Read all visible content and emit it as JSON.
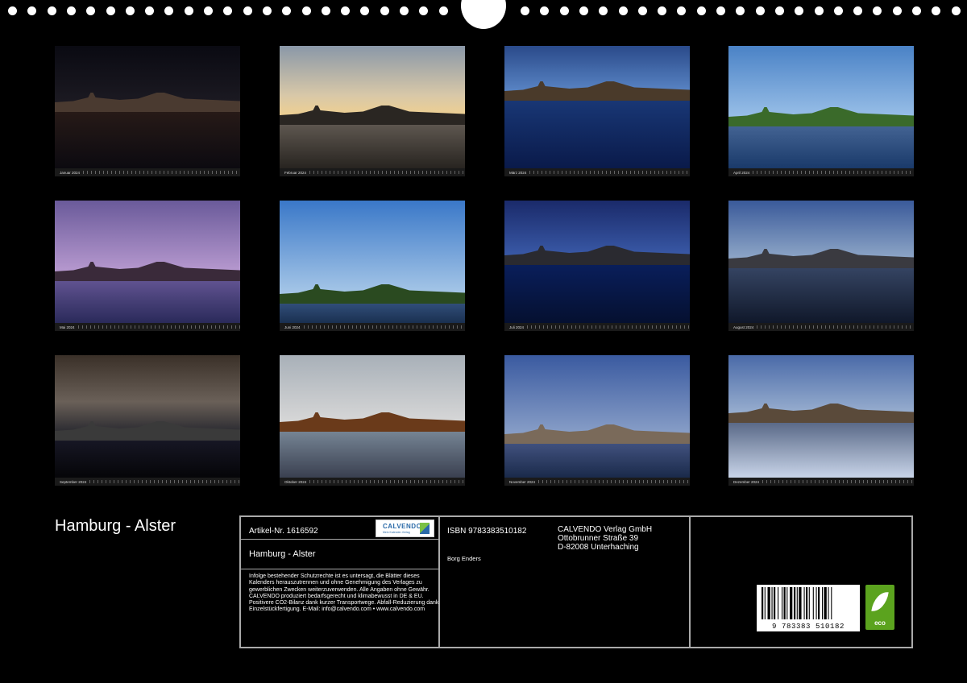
{
  "calendar": {
    "title": "Hamburg - Alster"
  },
  "months": [
    {
      "label": "Januar 2024"
    },
    {
      "label": "Februar 2024"
    },
    {
      "label": "März 2024"
    },
    {
      "label": "April 2024"
    },
    {
      "label": "Mai 2024"
    },
    {
      "label": "Juni 2024"
    },
    {
      "label": "Juli 2024"
    },
    {
      "label": "August 2024"
    },
    {
      "label": "September 2024"
    },
    {
      "label": "Oktober 2024"
    },
    {
      "label": "November 2024"
    },
    {
      "label": "Dezember 2024"
    }
  ],
  "info": {
    "article_no": "Artikel-Nr. 1616592",
    "logo_name": "CALVENDO",
    "logo_tagline": "Mein Kalender-Verlag",
    "product_title": "Hamburg - Alster",
    "legal_text": "Infolge bestehender Schutzrechte ist es untersagt, die Blätter dieses Kalenders herauszutrennen und ohne Genehmigung des Verlages zu gewerblichen Zwecken weiterzuverwenden. Alle Angaben ohne Gewähr. CALVENDO produziert bedarfsgerecht und klimabewusst in DE & EU. Positivere CO2-Bilanz dank kurzer Transportwege. Abfall-Reduzierung dank Einzelstückfertigung. E-Mail: info@calvendo.com • www.calvendo.com",
    "isbn": "ISBN 9783383510182",
    "author": "Borg Enders",
    "publisher_line1": "CALVENDO Verlag GmbH",
    "publisher_line2": "Ottobrunner Straße 39",
    "publisher_line3": "D-82008 Unterhaching",
    "barcode_number": "9 783383 510182",
    "eco_label": "eco"
  },
  "colors": {
    "background": "#000000",
    "frame": "#aaaaaa",
    "eco_green": "#5ba31e"
  }
}
